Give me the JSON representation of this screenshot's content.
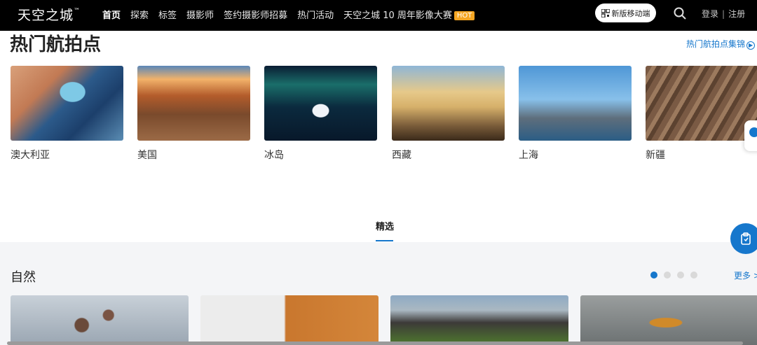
{
  "header": {
    "logo": "天空之城",
    "logo_tm": "™",
    "nav": [
      {
        "label": "首页",
        "active": true
      },
      {
        "label": "探索"
      },
      {
        "label": "标签"
      },
      {
        "label": "摄影师"
      },
      {
        "label": "签约摄影师招募"
      },
      {
        "label": "热门活动"
      },
      {
        "label": "天空之城 10 周年影像大赛"
      }
    ],
    "hot_badge": "HOT",
    "mobile_button": "新版移动端",
    "login": "登录",
    "separator": "|",
    "register": "注册"
  },
  "hot_spots": {
    "title": "热门航拍点",
    "more_link": "热门航拍点集锦",
    "items": [
      {
        "label": "澳大利亚"
      },
      {
        "label": "美国"
      },
      {
        "label": "冰岛"
      },
      {
        "label": "西藏"
      },
      {
        "label": "上海"
      },
      {
        "label": "新疆"
      }
    ]
  },
  "featured_tab": "精选",
  "nature": {
    "title": "自然",
    "more_link": "更多 >",
    "pages": 4,
    "active_page": 1
  },
  "colors": {
    "accent": "#1677cc",
    "hot": "#f5a623",
    "header_bg": "#000000"
  }
}
